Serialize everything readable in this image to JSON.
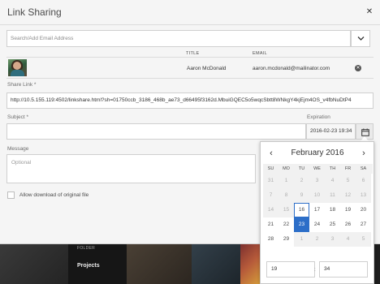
{
  "dialog": {
    "title": "Link Sharing",
    "close_icon": "close-icon"
  },
  "search": {
    "placeholder": "Search/Add Email Address",
    "dropdown_icon": "chevron-down-icon"
  },
  "columns": {
    "title": "TITLE",
    "email": "EMAIL"
  },
  "user": {
    "name": "Aaron McDonald",
    "email": "aaron.mcdonald@mailinator.com",
    "remove_icon": "remove-icon"
  },
  "share_link": {
    "label": "Share Link *",
    "value": "http://10.5.155.119:4502/linkshare.html?sh=01750ccb_3186_468b_ae73_d66495f3162d.MbuiGQEC5o5wqcSbtt8WNkgY4kjEjm4OS_v4fbNuDtP4"
  },
  "subject": {
    "label": "Subject *",
    "value": ""
  },
  "expiration": {
    "label": "Expiration",
    "value": "2016-02-23 19:34",
    "calendar_icon": "calendar-icon"
  },
  "message": {
    "label": "Message",
    "placeholder": "Optional"
  },
  "allow_download": {
    "label": "Allow download of original file",
    "checked": false
  },
  "calendar": {
    "month_label": "February 2016",
    "weekday_headers": [
      "SU",
      "MO",
      "TU",
      "WE",
      "TH",
      "FR",
      "SA"
    ],
    "weeks": [
      [
        "31",
        "1",
        "2",
        "3",
        "4",
        "5",
        "6"
      ],
      [
        "7",
        "8",
        "9",
        "10",
        "11",
        "12",
        "13"
      ],
      [
        "14",
        "15",
        "16",
        "17",
        "18",
        "19",
        "20"
      ],
      [
        "21",
        "22",
        "23",
        "24",
        "25",
        "26",
        "27"
      ],
      [
        "28",
        "29",
        "1",
        "2",
        "3",
        "4",
        "5"
      ]
    ],
    "today": "16",
    "selected": "23",
    "hour": "19",
    "minute": "34",
    "time_separator": ":",
    "colors": {
      "accent": "#2c6ec8"
    }
  },
  "background": {
    "folder_caption": "FOLDER",
    "folder_name": "Projects"
  }
}
